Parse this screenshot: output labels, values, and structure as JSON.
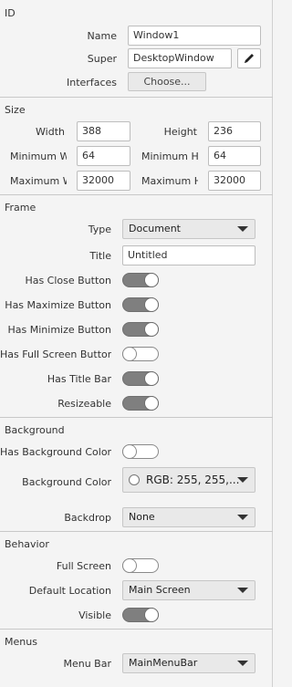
{
  "sections": {
    "id": "ID",
    "size": "Size",
    "frame": "Frame",
    "background": "Background",
    "behavior": "Behavior",
    "menus": "Menus"
  },
  "id": {
    "name_label": "Name",
    "name_value": "Window1",
    "super_label": "Super",
    "super_value": "DesktopWindow",
    "interfaces_label": "Interfaces",
    "interfaces_button": "Choose..."
  },
  "size": {
    "width_label": "Width",
    "width_value": "388",
    "height_label": "Height",
    "height_value": "236",
    "min_width_label": "Minimum Wi",
    "min_width_value": "64",
    "min_height_label": "Minimum He",
    "min_height_value": "64",
    "max_width_label": "Maximum W",
    "max_width_value": "32000",
    "max_height_label": "Maximum H",
    "max_height_value": "32000"
  },
  "frame": {
    "type_label": "Type",
    "type_value": "Document",
    "title_label": "Title",
    "title_value": "Untitled",
    "close_label": "Has Close Button",
    "close_on": true,
    "maximize_label": "Has Maximize Button",
    "maximize_on": true,
    "minimize_label": "Has Minimize Button",
    "minimize_on": true,
    "fullscreen_btn_label": "Has Full Screen Button",
    "fullscreen_btn_on": false,
    "titlebar_label": "Has Title Bar",
    "titlebar_on": true,
    "resizeable_label": "Resizeable",
    "resizeable_on": true
  },
  "background": {
    "has_color_label": "Has Background Color",
    "has_color_on": false,
    "color_label": "Background Color",
    "color_value": "RGB: 255, 255,...",
    "backdrop_label": "Backdrop",
    "backdrop_value": "None"
  },
  "behavior": {
    "fullscreen_label": "Full Screen",
    "fullscreen_on": false,
    "location_label": "Default Location",
    "location_value": "Main Screen",
    "visible_label": "Visible",
    "visible_on": true
  },
  "menus": {
    "menubar_label": "Menu Bar",
    "menubar_value": "MainMenuBar"
  },
  "colors": {
    "toggle_on": "#7f7f7f",
    "panel_bg": "#f4f4f4"
  }
}
